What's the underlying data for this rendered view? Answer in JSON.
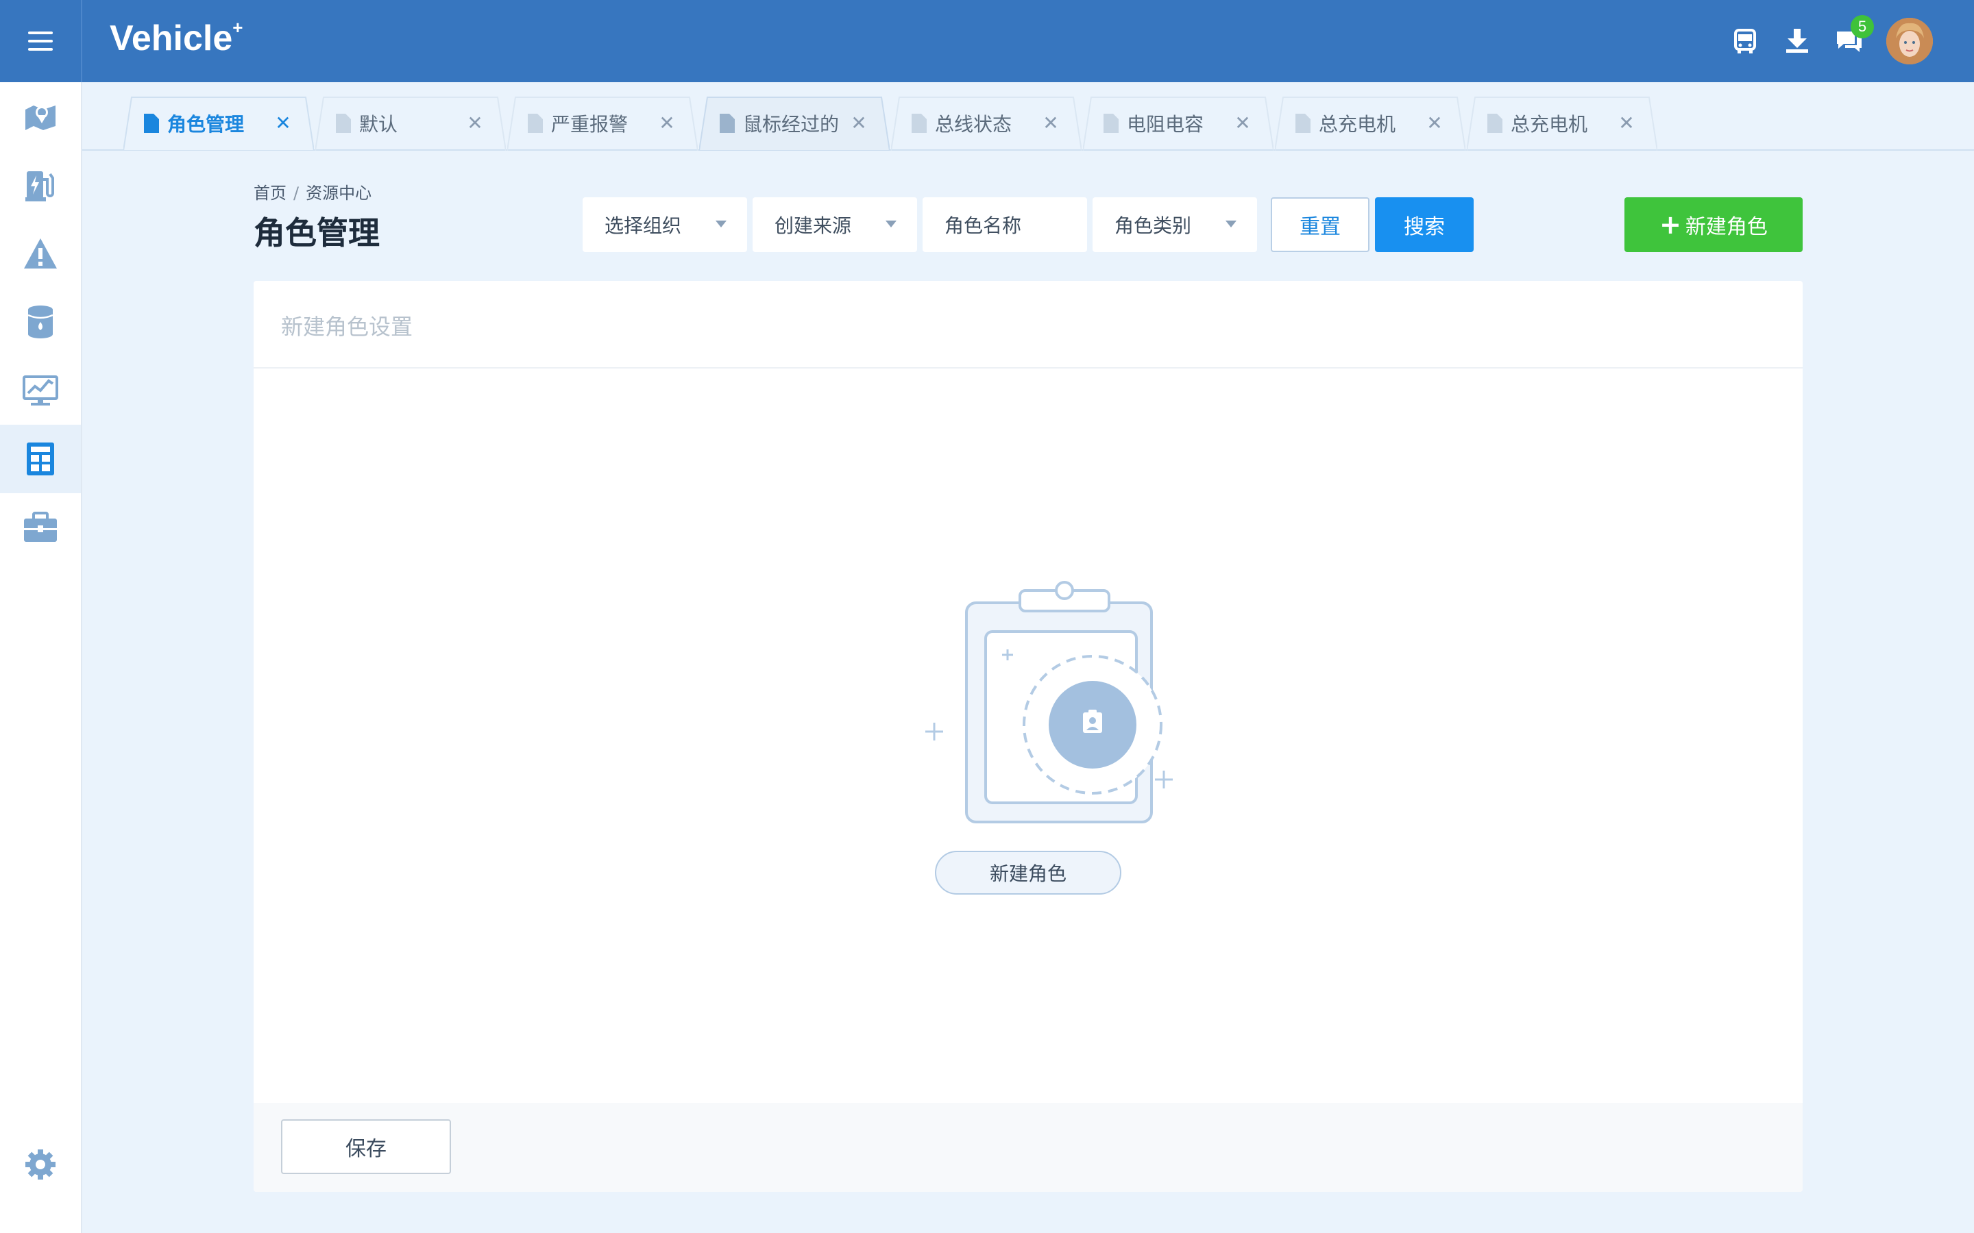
{
  "app": {
    "logo_text": "Vehicle",
    "logo_mark": "+"
  },
  "topbar": {
    "icons": [
      "bus-icon",
      "download-icon",
      "messages-icon"
    ],
    "message_badge": "5"
  },
  "sidebar": {
    "items": [
      {
        "icon": "map-icon",
        "active": false
      },
      {
        "icon": "charging-station-icon",
        "active": false
      },
      {
        "icon": "warning-icon",
        "active": false
      },
      {
        "icon": "database-icon",
        "active": false
      },
      {
        "icon": "monitor-chart-icon",
        "active": false
      },
      {
        "icon": "grid-icon",
        "active": true
      },
      {
        "icon": "briefcase-icon",
        "active": false
      }
    ],
    "settings_icon": "gear-icon"
  },
  "tabs": [
    {
      "label": "角色管理",
      "active": true
    },
    {
      "label": "默认",
      "active": false
    },
    {
      "label": "严重报警",
      "active": false
    },
    {
      "label": "鼠标经过的标",
      "active": false
    },
    {
      "label": "总线状态",
      "active": false
    },
    {
      "label": "电阻电容",
      "active": false
    },
    {
      "label": "总充电机",
      "active": false
    },
    {
      "label": "总充电机",
      "active": false
    }
  ],
  "breadcrumb": {
    "home": "首页",
    "separator": "/",
    "current": "资源中心"
  },
  "page_title": "角色管理",
  "filters": {
    "org": "选择组织",
    "source": "创建来源",
    "role_name": "角色名称",
    "role_type": "角色类别"
  },
  "buttons": {
    "reset": "重置",
    "search": "搜索",
    "new_role_plus": "+",
    "new_role": "新建角色",
    "save": "保存"
  },
  "panel": {
    "title": "新建角色设置",
    "empty_action": "新建角色"
  },
  "colors": {
    "topbar": "#3776bf",
    "accent": "#1890f0",
    "success": "#3fc43c",
    "badge": "#3fc23a",
    "background": "#eaf3fc"
  }
}
